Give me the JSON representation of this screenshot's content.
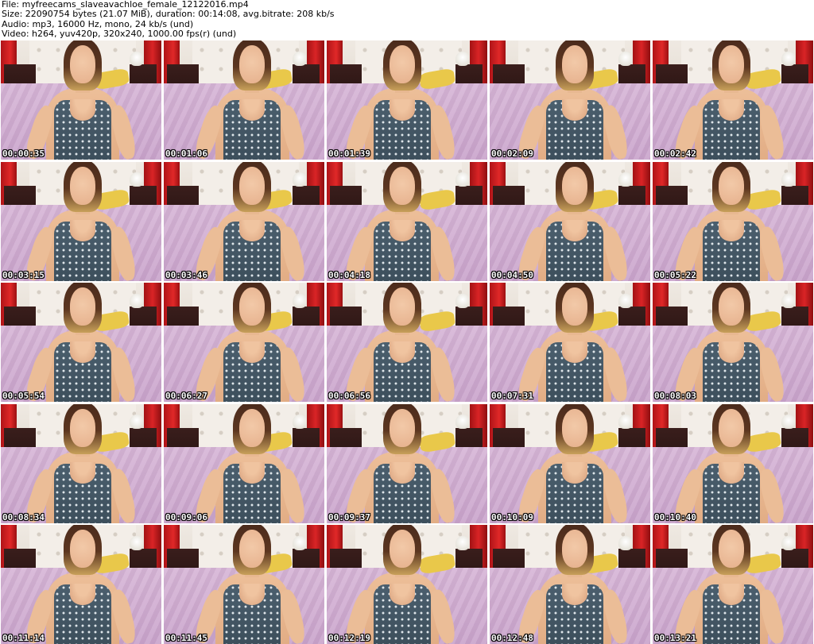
{
  "header": {
    "file_line": "File: myfreecams_slaveavachloe_female_12122016.mp4",
    "size_line": "Size: 22090754 bytes (21.07 MiB), duration: 00:14:08, avg.bitrate: 208 kb/s",
    "audio_line": "Audio: mp3, 16000 Hz, mono, 24 kb/s (und)",
    "video_line": "Video: h264, yuv420p, 320x240, 1000.00 fps(r) (und)"
  },
  "thumbnails": [
    {
      "timestamp": "00:00:35"
    },
    {
      "timestamp": "00:01:06"
    },
    {
      "timestamp": "00:01:39"
    },
    {
      "timestamp": "00:02:09"
    },
    {
      "timestamp": "00:02:42"
    },
    {
      "timestamp": "00:03:15"
    },
    {
      "timestamp": "00:03:46"
    },
    {
      "timestamp": "00:04:18"
    },
    {
      "timestamp": "00:04:50"
    },
    {
      "timestamp": "00:05:22"
    },
    {
      "timestamp": "00:05:54"
    },
    {
      "timestamp": "00:06:27"
    },
    {
      "timestamp": "00:06:56"
    },
    {
      "timestamp": "00:07:31"
    },
    {
      "timestamp": "00:08:03"
    },
    {
      "timestamp": "00:08:34"
    },
    {
      "timestamp": "00:09:06"
    },
    {
      "timestamp": "00:09:37"
    },
    {
      "timestamp": "00:10:09"
    },
    {
      "timestamp": "00:10:40"
    },
    {
      "timestamp": "00:11:14"
    },
    {
      "timestamp": "00:11:45"
    },
    {
      "timestamp": "00:12:19"
    },
    {
      "timestamp": "00:12:48"
    },
    {
      "timestamp": "00:13:21"
    }
  ]
}
